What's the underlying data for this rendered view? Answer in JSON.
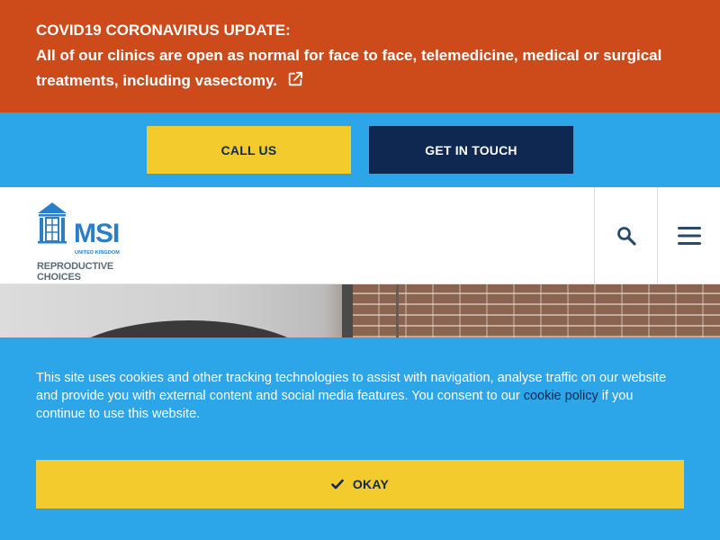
{
  "alert": {
    "title": "COVID19 CORONAVIRUS UPDATE:",
    "body": "All of our clinics are open as normal for face to face, telemedicine, medical or surgical treatments, including vasectomy.",
    "icon": "external-link-icon"
  },
  "cta": {
    "call_label": "CALL US",
    "touch_label": "GET IN TOUCH"
  },
  "header": {
    "logo": {
      "name": "MSI",
      "sub": "UNITED KINGDOM",
      "tagline_1": "REPRODUCTIVE",
      "tagline_2": "CHOICES"
    },
    "search_icon": "search-icon",
    "menu_icon": "hamburger-menu-icon"
  },
  "cookie": {
    "text_before": "This site uses cookies and other tracking technologies to assist with navigation, analyse traffic on our website and provide you with external content and social media features. You consent to our ",
    "link_label": "cookie policy",
    "text_after": " if you continue to use this website.",
    "okay_label": "OKAY",
    "okay_icon": "checkmark-icon"
  },
  "colors": {
    "alert_bg": "#cd4a1b",
    "brand_blue": "#2ca6e8",
    "navy": "#0e2852",
    "yellow": "#f4cb2c",
    "logo_blue": "#2a7fc6"
  }
}
